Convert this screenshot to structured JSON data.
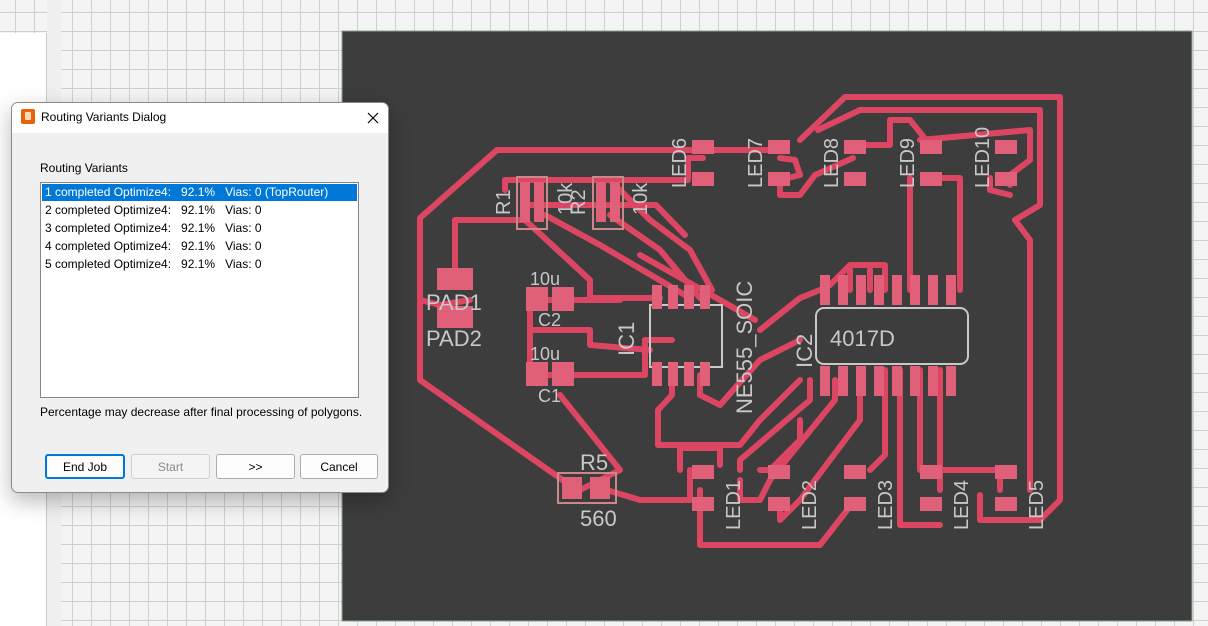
{
  "dialog": {
    "title": "Routing Variants Dialog",
    "section_label": "Routing Variants",
    "variants": [
      "1 completed Optimize4:   92.1%   Vias: 0 (TopRouter)",
      "2 completed Optimize4:   92.1%   Vias: 0",
      "3 completed Optimize4:   92.1%   Vias: 0",
      "4 completed Optimize4:   92.1%   Vias: 0",
      "5 completed Optimize4:   92.1%   Vias: 0"
    ],
    "selected_index": 0,
    "note": "Percentage may decrease after final processing of polygons.",
    "buttons": {
      "end_job": "End Job",
      "start": "Start",
      "next": ">>",
      "cancel": "Cancel"
    }
  },
  "board": {
    "labels": {
      "pad1": "PAD1",
      "pad2": "PAD2",
      "r1": "R1",
      "r1_value": "10k",
      "r2": "R2",
      "r2_value": "10k",
      "c2": "C2",
      "c2_value": "10u",
      "c1": "C1",
      "c1_value": "10u",
      "ic1": "IC1",
      "ic1_package": "NE555_SOIC",
      "ic2": "IC2",
      "ic2_value": "4017D",
      "r5": "R5",
      "r5_value": "560",
      "led1": "LED1",
      "led2": "LED2",
      "led3": "LED3",
      "led4": "LED4",
      "led5": "LED5",
      "led6": "LED6",
      "led7": "LED7",
      "led8": "LED8",
      "led9": "LED9",
      "led10": "LED10"
    },
    "colors": {
      "board": "#3d3d3d",
      "trace": "#dc4662",
      "pad": "#e0607a",
      "silkscreen": "#c8c8c8",
      "selection": "#0078d7"
    }
  }
}
